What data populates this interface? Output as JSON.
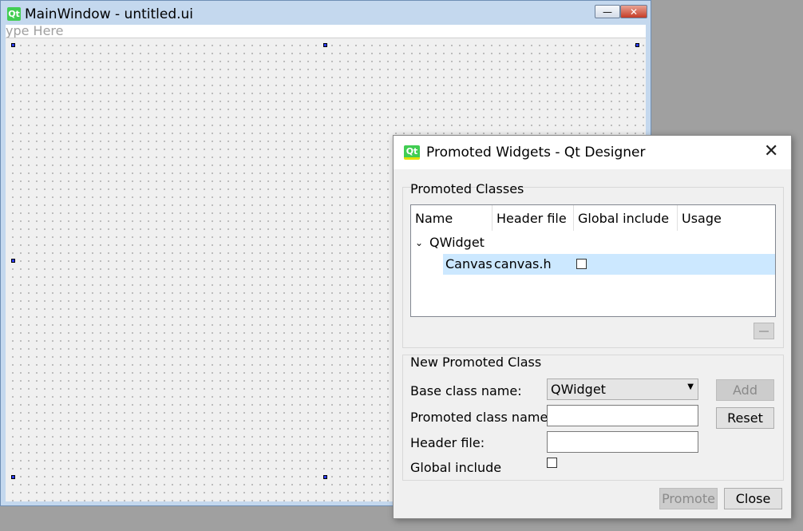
{
  "main_window": {
    "title": "MainWindow - untitled.ui",
    "logo_text": "Qt",
    "menu_placeholder": "ype Here",
    "minimize_glyph": "—",
    "close_glyph": "✕"
  },
  "dialog": {
    "title": "Promoted Widgets - Qt Designer",
    "logo_text": "Qt",
    "close_glyph": "✕",
    "promoted_classes": {
      "group_title": "Promoted Classes",
      "columns": [
        "Name",
        "Header file",
        "Global include",
        "Usage"
      ],
      "base_item": "QWidget",
      "rows": [
        {
          "name": "Canvas",
          "header_file": "canvas.h",
          "global_include": false,
          "usage": ""
        }
      ]
    },
    "new_promoted_class": {
      "group_title": "New Promoted Class",
      "base_class_label": "Base class name:",
      "base_class_value": "QWidget",
      "promoted_class_label": "Promoted class name:",
      "promoted_class_value": "",
      "header_file_label": "Header file:",
      "header_file_value": "",
      "global_include_label": "Global include",
      "global_include_checked": false
    },
    "buttons": {
      "add": "Add",
      "reset": "Reset",
      "promote": "Promote",
      "close": "Close"
    }
  },
  "colors": {
    "selection": "#cce8ff",
    "window_frame": "#c4d8ee",
    "qt_green": "#41cd52"
  },
  "icons": {
    "tree_expander": "chevron-down-icon",
    "dropdown": "dropdown-arrow-icon",
    "remove": "remove-icon"
  }
}
